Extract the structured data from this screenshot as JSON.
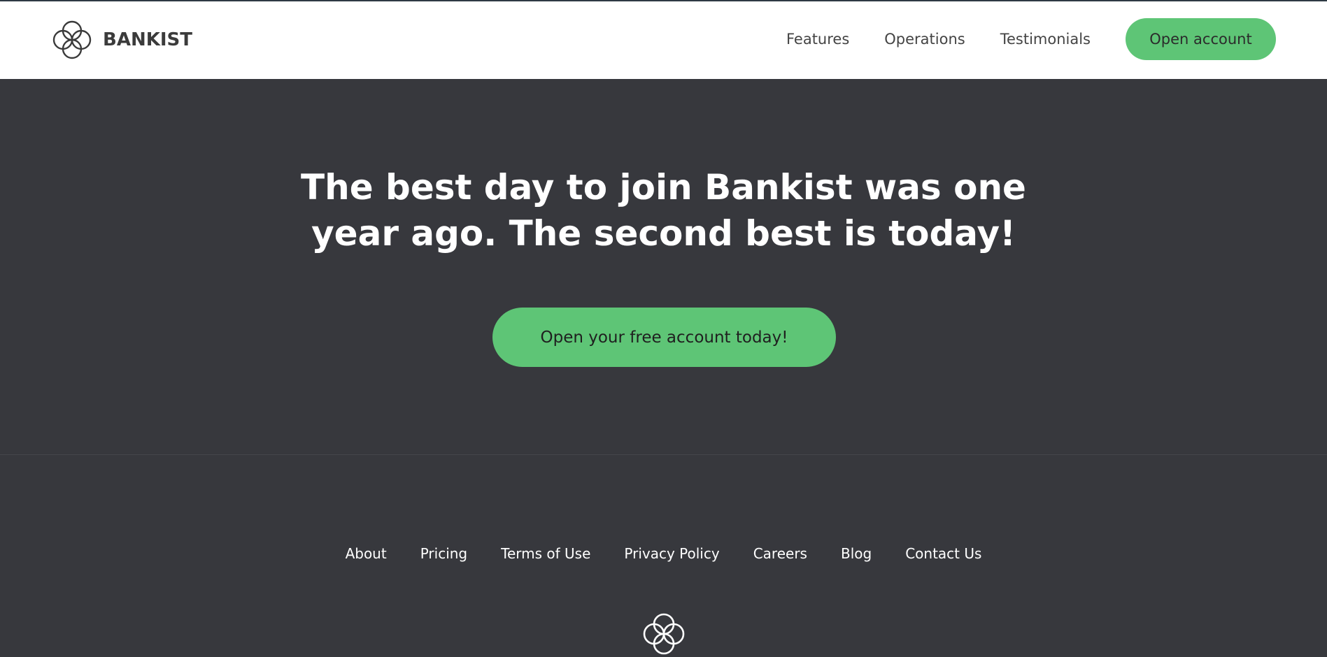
{
  "header": {
    "logo_text": "BANKIST",
    "nav": [
      {
        "label": "Features"
      },
      {
        "label": "Operations"
      },
      {
        "label": "Testimonials"
      }
    ],
    "cta_label": "Open account"
  },
  "signup": {
    "title_line1": "The best day to join Bankist was one",
    "title_line2": "year ago. The second best is today!",
    "button_label": "Open your free account today!"
  },
  "footer": {
    "links": [
      {
        "label": "About"
      },
      {
        "label": "Pricing"
      },
      {
        "label": "Terms of Use"
      },
      {
        "label": "Privacy Policy"
      },
      {
        "label": "Careers"
      },
      {
        "label": "Blog"
      },
      {
        "label": "Contact Us"
      }
    ]
  },
  "colors": {
    "accent": "#5ec576",
    "dark_bg": "#37383d",
    "header_bg": "#ffffff"
  },
  "icons": {
    "logo": "bankist-logo-icon",
    "footer_logo": "bankist-logo-icon"
  }
}
